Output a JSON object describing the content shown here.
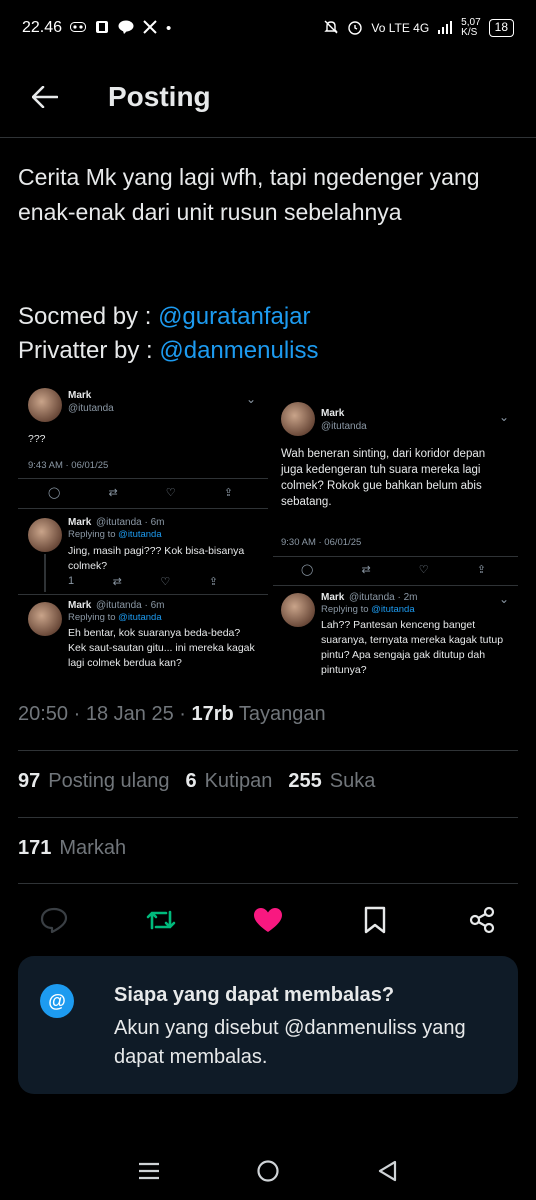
{
  "status_bar": {
    "time": "22.46",
    "dot": "•",
    "network": "Vo LTE 4G",
    "speed_value": "5,07",
    "speed_unit": "K/S",
    "battery": "18"
  },
  "header": {
    "title": "Posting"
  },
  "post": {
    "text": "Cerita Mk yang lagi wfh, tapi ngedenger yang enak-enak dari unit rusun sebelahnya",
    "socmed_label": "Socmed by : ",
    "socmed_mention": "@guratanfajar",
    "privatter_label": "Privatter by : ",
    "privatter_mention": "@danmenuliss"
  },
  "media": {
    "left": {
      "tweet1": {
        "name": "Mark",
        "handle": "@itutanda",
        "body": "???",
        "meta": "9:43 AM · 06/01/25"
      },
      "reply1": {
        "name": "Mark",
        "handle": "@itutanda · 6m",
        "replying": "Replying to ",
        "replying_handle": "@itutanda",
        "body": "Jing, masih pagi??? Kok bisa-bisanya colmek?",
        "count": "1"
      },
      "reply2": {
        "name": "Mark",
        "handle": "@itutanda · 6m",
        "replying": "Replying to ",
        "replying_handle": "@itutanda",
        "body": "Eh bentar, kok suaranya beda-beda? Kek saut-sautan gitu... ini mereka kagak lagi colmek berdua kan?"
      }
    },
    "right": {
      "tweet1": {
        "name": "Mark",
        "handle": "@itutanda",
        "body": "Wah beneran sinting, dari koridor depan juga kedengeran tuh suara mereka lagi colmek? Rokok gue bahkan belum abis sebatang.",
        "meta": "9:30 AM · 06/01/25"
      },
      "reply1": {
        "name": "Mark",
        "handle": "@itutanda · 2m",
        "replying": "Replying to ",
        "replying_handle": "@itutanda",
        "body": "Lah?? Pantesan kenceng banget suaranya, ternyata mereka kagak tutup pintu? Apa sengaja gak ditutup dah pintunya?"
      }
    }
  },
  "timestamp": {
    "time": "20:50",
    "sep1": " · ",
    "date": "18 Jan 25",
    "sep2": " · ",
    "views": "17rb",
    "views_label": " Tayangan"
  },
  "stats": {
    "reposts": "97",
    "reposts_label": "Posting ulang",
    "quotes": "6",
    "quotes_label": "Kutipan",
    "likes": "255",
    "likes_label": "Suka",
    "bookmarks": "171",
    "bookmarks_label": "Markah"
  },
  "actions": {
    "reply_icon": "reply-icon",
    "repost_icon": "repost-icon",
    "like_icon": "heart-icon",
    "bookmark_icon": "bookmark-icon",
    "share_icon": "share-icon",
    "repost_color": "#00ba7c",
    "like_color": "#f91880"
  },
  "reply_restriction": {
    "icon": "@",
    "title": "Siapa yang dapat membalas?",
    "description": "Akun yang disebut @danmenuliss yang dapat membalas."
  },
  "colors": {
    "accent": "#1d9bf0",
    "background": "#000000",
    "card": "#0f1b27"
  }
}
